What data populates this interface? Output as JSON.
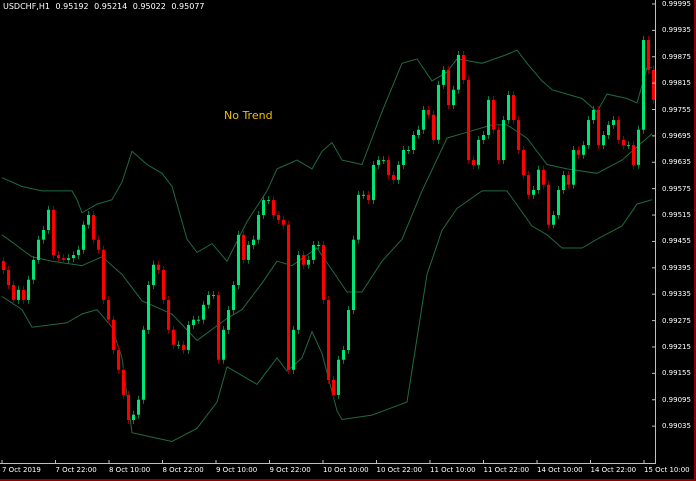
{
  "header": {
    "symbol": "USDCHF,H1",
    "open": "0.95192",
    "high": "0.95214",
    "low": "0.95022",
    "close": "0.95077"
  },
  "annotation": "No Trend",
  "colors": {
    "bull": "#00e676",
    "bear": "#ff0000",
    "bands": "#1f6b3f",
    "background": "#000000",
    "text": "#ffffff",
    "annotation": "#f0c000"
  },
  "chart_data": {
    "type": "candlestick",
    "title": "",
    "ylim": [
      0.98958,
      1.00004
    ],
    "y_ticks": [
      "0.99995",
      "0.99935",
      "0.99875",
      "0.99815",
      "0.99755",
      "0.99695",
      "0.99635",
      "0.99575",
      "0.99515",
      "0.99455",
      "0.99395",
      "0.99335",
      "0.99275",
      "0.99215",
      "0.99155",
      "0.99095",
      "0.99035"
    ],
    "x_ticks": [
      "7 Oct 2019",
      "7 Oct 22:00",
      "8 Oct 10:00",
      "8 Oct 22:00",
      "9 Oct 10:00",
      "9 Oct 22:00",
      "10 Oct 10:00",
      "10 Oct 22:00",
      "11 Oct 10:00",
      "11 Oct 22:00",
      "14 Oct 10:00",
      "14 Oct 22:00",
      "15 Oct 10:00"
    ],
    "close": [
      0.9939,
      0.99356,
      0.99322,
      0.99345,
      0.99322,
      0.99368,
      0.99413,
      0.99459,
      0.99481,
      0.99527,
      0.99424,
      0.99417,
      0.99413,
      0.99417,
      0.99424,
      0.99436,
      0.99493,
      0.99515,
      0.99459,
      0.99436,
      0.99322,
      0.99277,
      0.99208,
      0.99163,
      0.99106,
      0.99049,
      0.99061,
      0.99095,
      0.99254,
      0.99356,
      0.99402,
      0.9939,
      0.99322,
      0.99254,
      0.9922,
      0.9922,
      0.99208,
      0.99265,
      0.99277,
      0.99277,
      0.99311,
      0.99333,
      0.99333,
      0.99186,
      0.99254,
      0.99299,
      0.99356,
      0.9947,
      0.99413,
      0.99447,
      0.99459,
      0.99515,
      0.99549,
      0.99549,
      0.99515,
      0.99504,
      0.99493,
      0.99163,
      0.99254,
      0.99424,
      0.99402,
      0.99413,
      0.99447,
      0.99447,
      0.99322,
      0.9914,
      0.99106,
      0.99186,
      0.99208,
      0.99299,
      0.99459,
      0.99561,
      0.99561,
      0.99549,
      0.99629,
      0.9964,
      0.9964,
      0.99606,
      0.99595,
      0.99629,
      0.99663,
      0.99663,
      0.99697,
      0.99709,
      0.99754,
      0.99743,
      0.99686,
      0.99811,
      0.99845,
      0.99765,
      0.998,
      0.99879,
      0.99822,
      0.9964,
      0.99629,
      0.99686,
      0.99697,
      0.99777,
      0.99709,
      0.9964,
      0.99731,
      0.99788,
      0.99731,
      0.99663,
      0.99606,
      0.99561,
      0.99572,
      0.99618,
      0.99584,
      0.99493,
      0.99515,
      0.99572,
      0.99606,
      0.99584,
      0.99663,
      0.99652,
      0.99674,
      0.99731,
      0.99754,
      0.99674,
      0.99697,
      0.9972,
      0.99731,
      0.99686,
      0.99674,
      0.99674,
      0.99629,
      0.99709,
      0.99913,
      0.99845,
      0.99777
    ],
    "bands": {
      "upper": [
        [
          0,
          0.996
        ],
        [
          4,
          0.9958
        ],
        [
          8,
          0.9957
        ],
        [
          14,
          0.9957
        ],
        [
          15,
          0.9955
        ],
        [
          16,
          0.9952
        ],
        [
          19,
          0.9954
        ],
        [
          22,
          0.9955
        ],
        [
          24,
          0.9959
        ],
        [
          26,
          0.9966
        ],
        [
          29,
          0.9963
        ],
        [
          32,
          0.9961
        ],
        [
          34,
          0.9958
        ],
        [
          37,
          0.9946
        ],
        [
          39,
          0.9943
        ],
        [
          42,
          0.9945
        ],
        [
          45,
          0.9941
        ],
        [
          49,
          0.995
        ],
        [
          53,
          0.9957
        ],
        [
          55,
          0.9962
        ],
        [
          57,
          0.9963
        ],
        [
          59,
          0.9964
        ],
        [
          62,
          0.9962
        ],
        [
          64,
          0.9966
        ],
        [
          66,
          0.9968
        ],
        [
          68,
          0.9964
        ],
        [
          72,
          0.9963
        ],
        [
          76,
          0.9975
        ],
        [
          80,
          0.9986
        ],
        [
          83,
          0.9987
        ],
        [
          86,
          0.9982
        ],
        [
          89,
          0.9984
        ],
        [
          91,
          0.9987
        ],
        [
          96,
          0.9986
        ],
        [
          101,
          0.9988
        ],
        [
          103,
          0.9989
        ],
        [
          105,
          0.9986
        ],
        [
          108,
          0.9982
        ],
        [
          110,
          0.998
        ],
        [
          113,
          0.9979
        ],
        [
          116,
          0.9978
        ],
        [
          119,
          0.9975
        ],
        [
          121,
          0.9979
        ],
        [
          125,
          0.9978
        ],
        [
          127,
          0.9977
        ],
        [
          129,
          0.9985
        ],
        [
          130,
          0.9985
        ]
      ],
      "middle": [
        [
          0,
          0.9947
        ],
        [
          6,
          0.9942
        ],
        [
          10,
          0.9941
        ],
        [
          16,
          0.994
        ],
        [
          20,
          0.9942
        ],
        [
          24,
          0.9938
        ],
        [
          28,
          0.9932
        ],
        [
          34,
          0.9929
        ],
        [
          39,
          0.9923
        ],
        [
          45,
          0.9928
        ],
        [
          48,
          0.993
        ],
        [
          52,
          0.9936
        ],
        [
          55,
          0.9941
        ],
        [
          58,
          0.994
        ],
        [
          63,
          0.9944
        ],
        [
          66,
          0.9939
        ],
        [
          69,
          0.9934
        ],
        [
          72,
          0.9934
        ],
        [
          76,
          0.9941
        ],
        [
          80,
          0.9946
        ],
        [
          84,
          0.9957
        ],
        [
          89,
          0.9969
        ],
        [
          92,
          0.997
        ],
        [
          98,
          0.9972
        ],
        [
          101,
          0.9972
        ],
        [
          105,
          0.9969
        ],
        [
          109,
          0.9963
        ],
        [
          113,
          0.9962
        ],
        [
          119,
          0.9961
        ],
        [
          124,
          0.9964
        ],
        [
          128,
          0.9968
        ],
        [
          130,
          0.997
        ]
      ],
      "lower": [
        [
          0,
          0.9933
        ],
        [
          4,
          0.993
        ],
        [
          6,
          0.9926
        ],
        [
          13,
          0.9927
        ],
        [
          16,
          0.9929
        ],
        [
          19,
          0.993
        ],
        [
          22,
          0.9926
        ],
        [
          24,
          0.9919
        ],
        [
          26,
          0.9902
        ],
        [
          30,
          0.9901
        ],
        [
          34,
          0.99
        ],
        [
          39,
          0.9903
        ],
        [
          43,
          0.9909
        ],
        [
          45,
          0.9917
        ],
        [
          48,
          0.9915
        ],
        [
          51,
          0.9913
        ],
        [
          55,
          0.9919
        ],
        [
          57,
          0.9916
        ],
        [
          60,
          0.9919
        ],
        [
          62,
          0.9925
        ],
        [
          64,
          0.992
        ],
        [
          67,
          0.9907
        ],
        [
          68,
          0.9905
        ],
        [
          74,
          0.9906
        ],
        [
          81,
          0.9909
        ],
        [
          85,
          0.9938
        ],
        [
          88,
          0.9948
        ],
        [
          91,
          0.9953
        ],
        [
          96,
          0.9957
        ],
        [
          101,
          0.9957
        ],
        [
          106,
          0.9949
        ],
        [
          109,
          0.9947
        ],
        [
          112,
          0.9944
        ],
        [
          116,
          0.9944
        ],
        [
          119,
          0.9946
        ],
        [
          124,
          0.9949
        ],
        [
          127,
          0.9954
        ],
        [
          130,
          0.9955
        ]
      ]
    }
  }
}
